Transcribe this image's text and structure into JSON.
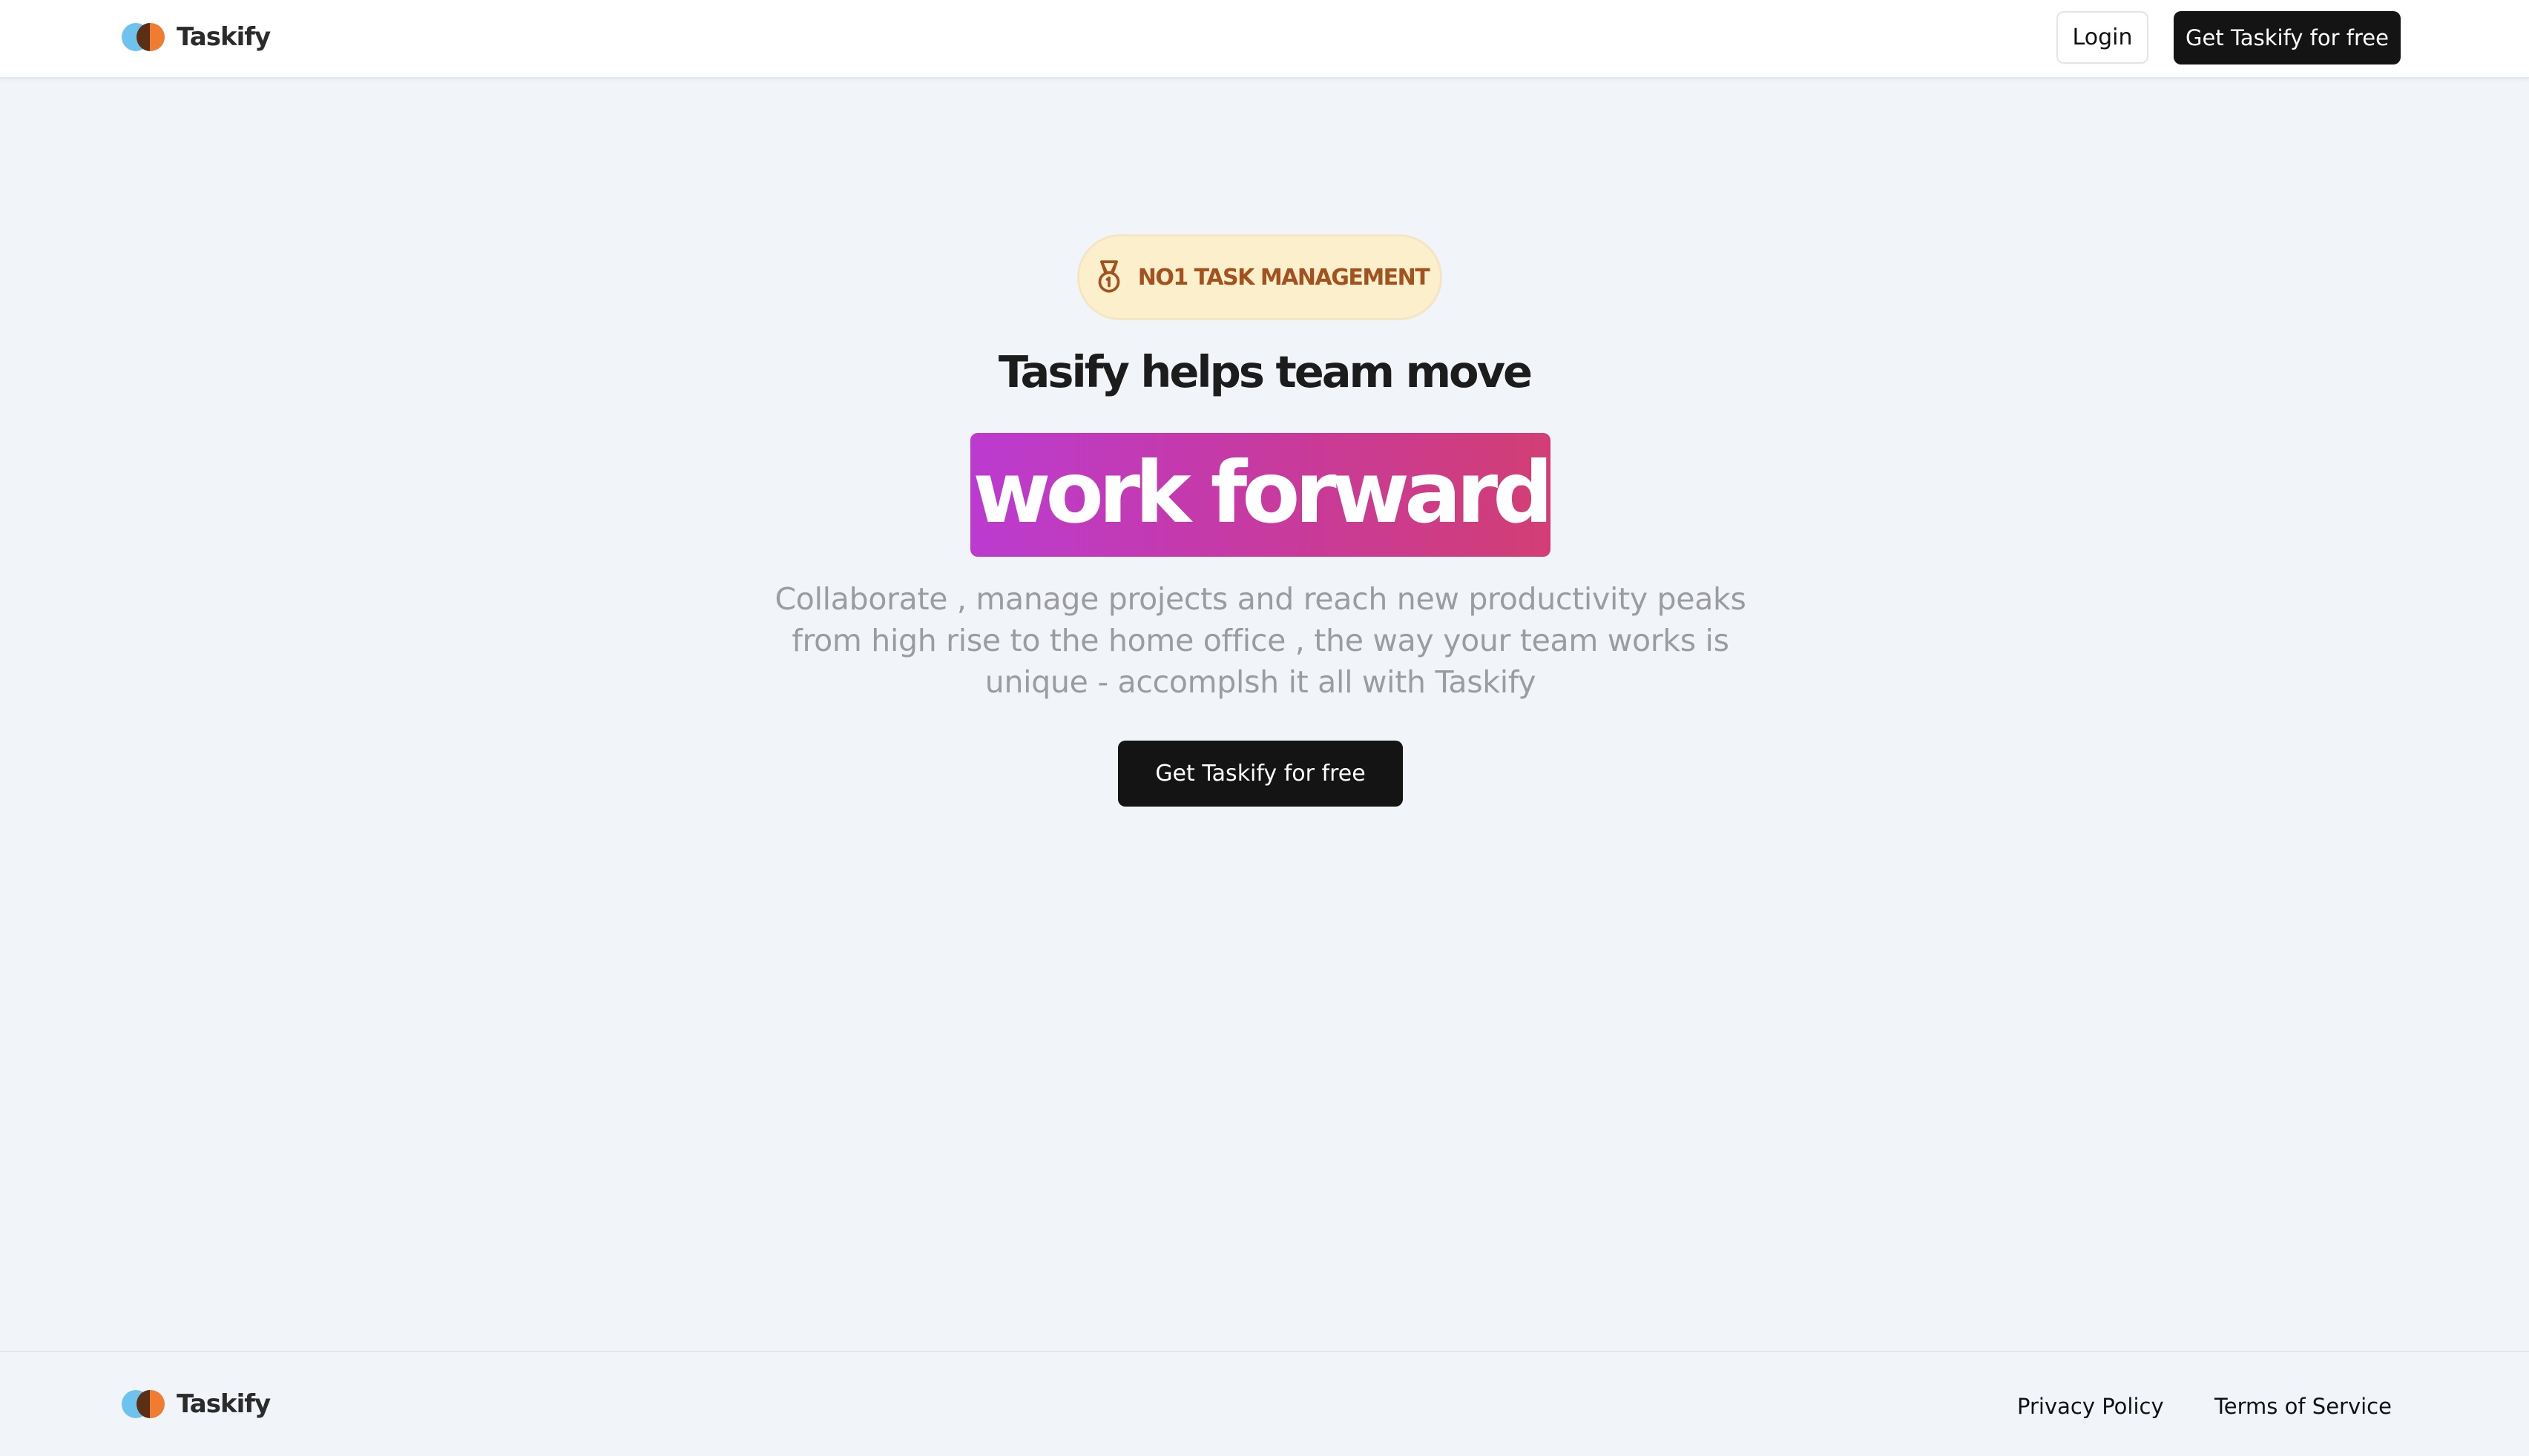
{
  "brand": {
    "name": "Taskify",
    "logo_colors": {
      "left": "#6ec3ee",
      "right": "#f07c31",
      "overlap": "#5a2f14"
    }
  },
  "header": {
    "login_label": "Login",
    "cta_label": "Get Taskify for free"
  },
  "hero": {
    "badge_icon": "medal-icon",
    "badge_text": "NO1 TASK MANAGEMENT",
    "title": "Tasify helps team move",
    "highlight": "work forward",
    "highlight_gradient": [
      "#bb3bd0",
      "#d23e74"
    ],
    "description_lines": [
      "Collaborate , manage projects and reach new productivity peaks",
      "from high rise to the home office , the way your team works is",
      "unique - accomplsh it all with Taskify"
    ],
    "cta_label": "Get Taskify for free"
  },
  "footer": {
    "brand_name": "Taskify",
    "links": [
      "Privacy Policy",
      "Terms of Service"
    ]
  },
  "colors": {
    "page_bg": "#f1f4f9",
    "dark_button": "#141414",
    "badge_bg": "#fcefcb",
    "badge_text": "#a2521f"
  }
}
